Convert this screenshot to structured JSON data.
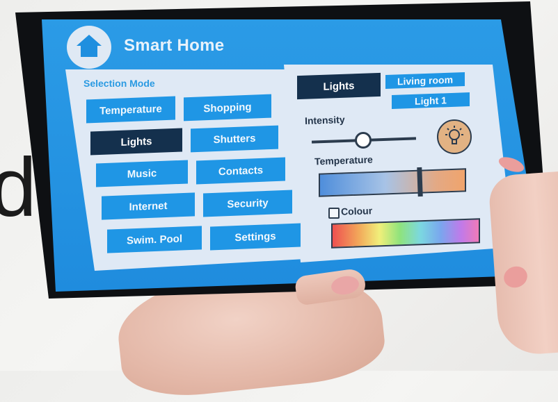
{
  "background_text": "d",
  "header": {
    "title": "Smart Home",
    "home_icon": "home-icon"
  },
  "selection": {
    "heading": "Selection Mode",
    "buttons": [
      {
        "label": "Temperature"
      },
      {
        "label": "Shopping"
      },
      {
        "label": "Lights"
      },
      {
        "label": "Shutters"
      },
      {
        "label": "Music"
      },
      {
        "label": "Contacts"
      },
      {
        "label": "Internet"
      },
      {
        "label": "Security"
      },
      {
        "label": "Swim. Pool"
      },
      {
        "label": "Settings"
      }
    ],
    "active": "Lights"
  },
  "detail": {
    "mode_label": "Lights",
    "room": "Living room",
    "device": "Light 1",
    "intensity_label": "Intensity",
    "intensity_level": 0.45,
    "bulb_icon": "lightbulb-icon",
    "temperature_label": "Temperature",
    "temperature_level": 0.72,
    "colour_label": "Colour",
    "colour_checked": false
  },
  "colors": {
    "accent": "#1f96e5",
    "active": "#14304d",
    "panel": "#dfe9f5",
    "screen": "#2b9be6"
  }
}
